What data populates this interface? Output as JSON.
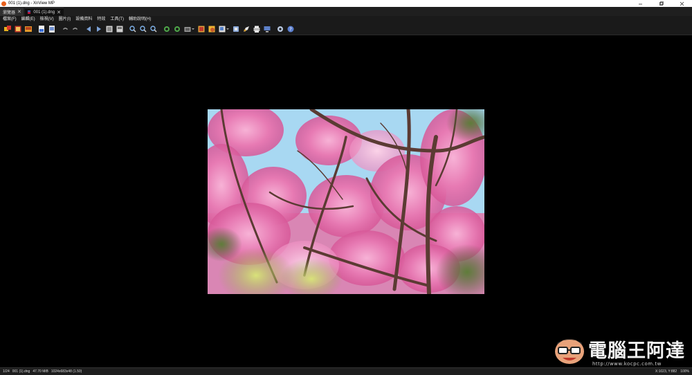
{
  "window": {
    "title": "001 (1).dng - XnView MP",
    "icons": {
      "app": "xnview-app-icon",
      "minimize": "minimize-icon",
      "maximize": "maximize-icon",
      "close": "close-icon"
    }
  },
  "tabs": [
    {
      "label": "瀏覽器",
      "close": "✕",
      "active": false
    },
    {
      "label": "001 (1).dng",
      "close": "✕",
      "active": true
    }
  ],
  "menu": {
    "items": [
      "檔案(F)",
      "編輯(E)",
      "檢視(V)",
      "圖片(I)",
      "設備資料",
      "特效",
      "工具(T)",
      "輔助說明(H)"
    ]
  },
  "toolbar": {
    "buttons": [
      "browser-icon",
      "fullscreen-icon",
      "slideshow-icon",
      "save-icon",
      "save-as-icon",
      "undo-icon",
      "redo-icon",
      "previous-icon",
      "next-icon",
      "first-page-icon",
      "last-page-icon",
      "zoom-in-icon",
      "zoom-out-icon",
      "zoom-fit-icon",
      "rotate-left-icon",
      "rotate-right-icon",
      "crop-icon",
      "adjust-icon",
      "effects-icon",
      "resize-icon",
      "color-icon",
      "paint-icon",
      "print-icon",
      "monitor-icon",
      "settings-icon",
      "help-icon"
    ]
  },
  "viewer": {
    "image": "pink-blossom-photo"
  },
  "watermark": {
    "text": "電腦王阿達",
    "url": "http://www.kocpc.com.tw",
    "mascot": "mascot-face-icon"
  },
  "status": {
    "position": "1/24",
    "filename": "001 (1).dng",
    "filesize": "47.70 MiB",
    "dimensions": "1024x683x48 (1.50)",
    "coords": "X:1023, Y:882",
    "zoom": "100%"
  },
  "colors": {
    "chrome": "#1a1a1a",
    "titlebar": "#ffffff",
    "accent": "#e8601c"
  }
}
